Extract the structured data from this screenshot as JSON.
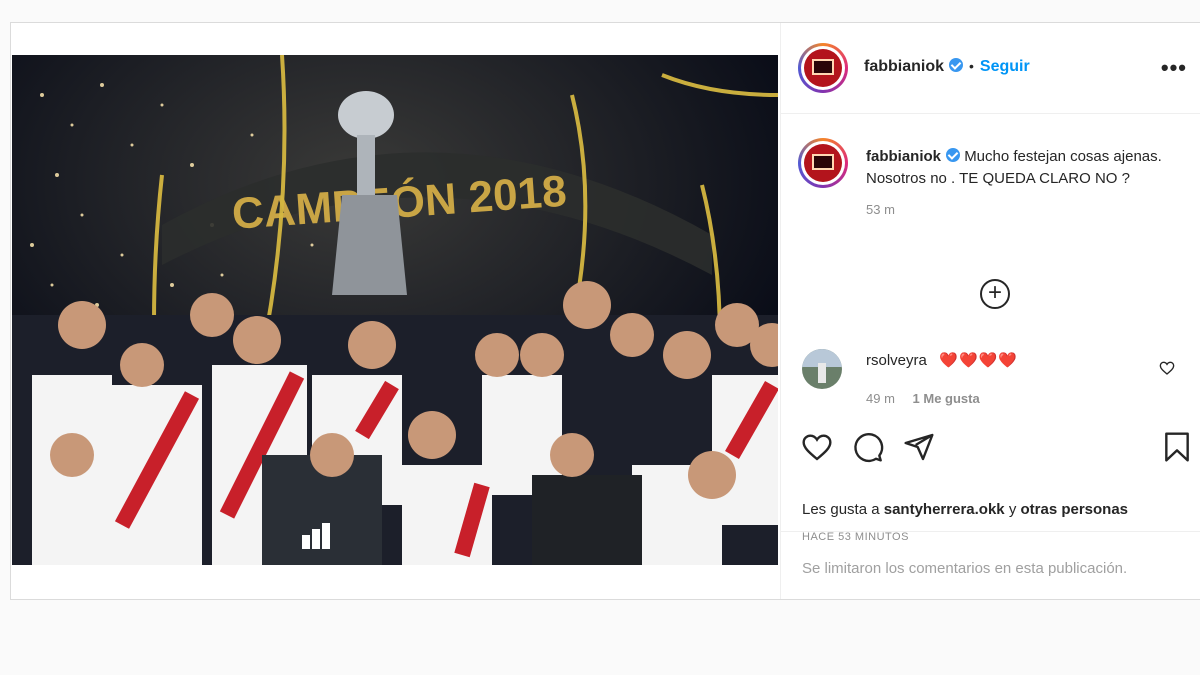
{
  "post": {
    "author": "fabbianiok",
    "follow_label": "Seguir",
    "separator": "•",
    "caption": "Mucho festejan cosas ajenas. Nosotros no . TE QUEDA CLARO NO ?",
    "caption_time": "53 m",
    "photo_banner_text": "CAMPEÓN 2018"
  },
  "comments": [
    {
      "user": "rsolveyra",
      "text": "❤️❤️❤️❤️",
      "time": "49 m",
      "likes": "1 Me gusta"
    }
  ],
  "likes": {
    "prefix": "Les gusta a",
    "user": "santyherrera.okk",
    "connector": "y",
    "others": "otras personas"
  },
  "time_ago": "HACE 53 MINUTOS",
  "comments_limited": "Se limitaron los comentarios en esta publicación.",
  "colors": {
    "accent": "#0095f6",
    "verified": "#3897f0",
    "heart": "#ed4956",
    "muted": "#8e8e8e"
  },
  "icons": [
    "verified-badge-icon",
    "more-options-icon",
    "load-more-comments-icon",
    "comment-like-icon",
    "like-icon",
    "comment-icon",
    "share-icon",
    "save-icon"
  ]
}
